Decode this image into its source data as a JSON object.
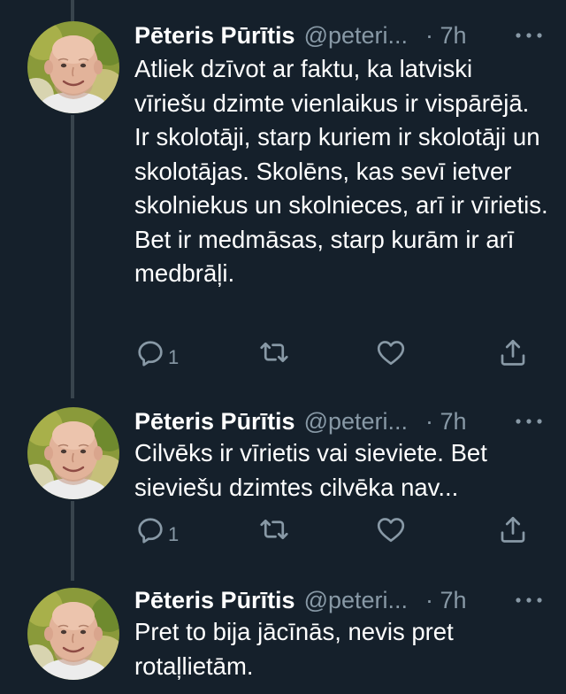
{
  "thread": {
    "tweets": [
      {
        "author_name": "Pēteris Pūrītis",
        "handle": "@peteri...",
        "time": "· 7h",
        "text": "Atliek dzīvot ar faktu, ka latviski vīriešu dzimte vienlaikus ir vispārējā. Ir skolotāji, starp kuriem ir skolotāji un skolotājas. Skolēns, kas sevī ietver skolniekus un skolnieces, arī ir vīrietis. Bet ir medmāsas, starp kurām ir arī medbrāļi.",
        "reply_count": "1",
        "icons": [
          "reply-icon",
          "retweet-icon",
          "like-icon",
          "share-icon",
          "more-icon"
        ]
      },
      {
        "author_name": "Pēteris Pūrītis",
        "handle": "@peteri...",
        "time": "· 7h",
        "text": "Cilvēks ir vīrietis vai sieviete. Bet sieviešu dzimtes cilvēka nav...",
        "reply_count": "1",
        "icons": [
          "reply-icon",
          "retweet-icon",
          "like-icon",
          "share-icon",
          "more-icon"
        ]
      },
      {
        "author_name": "Pēteris Pūrītis",
        "handle": "@peteri...",
        "time": "· 7h",
        "text": "Pret to bija jācīnās, nevis pret rotaļlietām.",
        "icons": [
          "more-icon"
        ]
      }
    ]
  },
  "colors": {
    "background": "#15202b",
    "text_primary": "#ffffff",
    "text_secondary": "#8899a6",
    "thread_line": "#38444d"
  }
}
